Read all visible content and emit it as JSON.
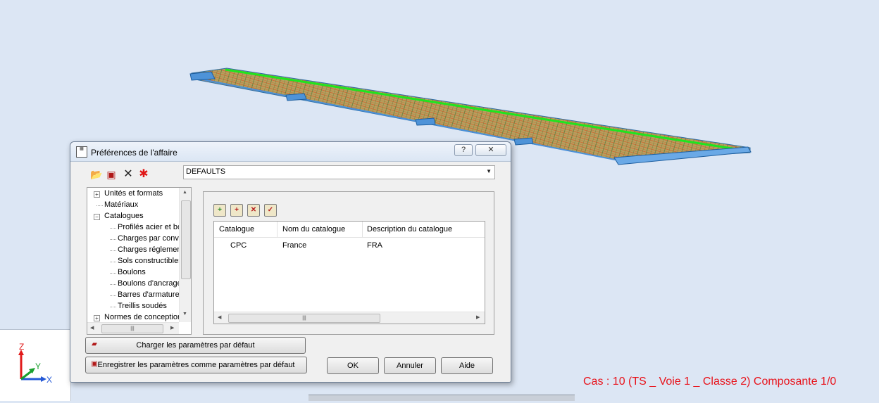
{
  "dialog": {
    "title": "Préférences de l'affaire",
    "help_label": "?",
    "close_label": "✕",
    "profile_select": {
      "value": "DEFAULTS"
    },
    "tree": {
      "items": [
        {
          "label": "Unités et formats"
        },
        {
          "label": "Matériaux"
        },
        {
          "label": "Catalogues"
        },
        {
          "label": "Profilés acier et bo"
        },
        {
          "label": "Charges par conve"
        },
        {
          "label": "Charges réglemen"
        },
        {
          "label": "Sols constructibles"
        },
        {
          "label": "Boulons"
        },
        {
          "label": "Boulons d'ancrage"
        },
        {
          "label": "Barres d'armature"
        },
        {
          "label": "Treillis soudés"
        },
        {
          "label": "Normes de conception"
        }
      ]
    },
    "catalog_table": {
      "headers": [
        "Catalogue",
        "Nom du catalogue",
        "Description du catalogue"
      ],
      "rows": [
        [
          "CPC",
          "France",
          "FRA"
        ]
      ]
    },
    "buttons": {
      "load_defaults": "Charger les paramètres par défaut",
      "save_defaults": "Enregistrer les paramètres comme paramètres par défaut",
      "ok": "OK",
      "cancel": "Annuler",
      "help": "Aide"
    }
  },
  "status": {
    "case_text": "Cas : 10 (TS _ Voie 1 _ Classe 2) Composante 1/0"
  },
  "axes": {
    "z": "Z",
    "y": "Y",
    "x": "X"
  },
  "colors": {
    "viewport_bg": "#dce6f4",
    "deck_green": "#1ee51e",
    "support_blue": "#3d8fd9",
    "status_red": "#e8131b"
  },
  "icons": [
    "open-folder-icon",
    "save-icon",
    "delete-icon",
    "reset-icon",
    "add-catalog-icon",
    "import-catalog-icon",
    "remove-catalog-icon",
    "check-catalog-icon"
  ]
}
